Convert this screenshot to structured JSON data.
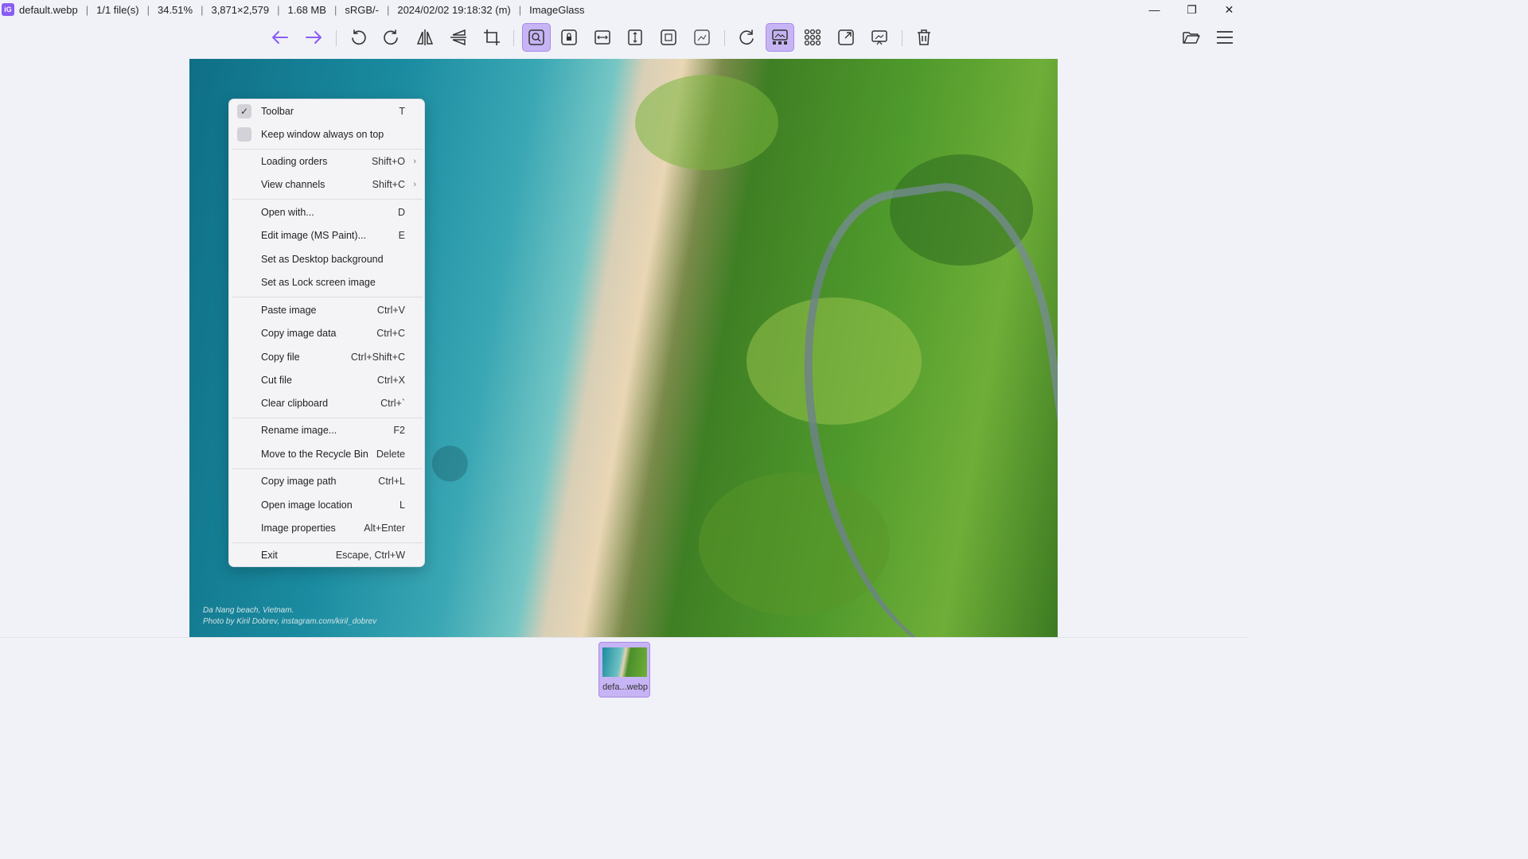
{
  "titlebar": {
    "app_icon_text": "iG",
    "filename": "default.webp",
    "file_count": "1/1 file(s)",
    "zoom": "34.51%",
    "dimensions": "3,871×2,579",
    "file_size": "1.68 MB",
    "color_profile": "sRGB/-",
    "date": "2024/02/02 19:18:32 (m)",
    "app_name": "ImageGlass",
    "separator": "|"
  },
  "window_controls": {
    "minimize": "—",
    "restore": "❐",
    "close": "✕"
  },
  "toolbar": {
    "accent_color": "#8a5cf6",
    "active_bg": "#c6b4f4",
    "buttons": [
      {
        "name": "previous-image-button",
        "icon": "arrow-left-icon",
        "active": false
      },
      {
        "name": "next-image-button",
        "icon": "arrow-right-icon",
        "active": false
      },
      {
        "name": "rotate-left-button",
        "icon": "rotate-left-icon",
        "active": false
      },
      {
        "name": "rotate-right-button",
        "icon": "rotate-right-icon",
        "active": false
      },
      {
        "name": "flip-horizontal-button",
        "icon": "flip-horizontal-icon",
        "active": false
      },
      {
        "name": "flip-vertical-button",
        "icon": "flip-vertical-icon",
        "active": false
      },
      {
        "name": "crop-button",
        "icon": "crop-icon",
        "active": false
      },
      {
        "name": "auto-zoom-button",
        "icon": "auto-zoom-icon",
        "active": true
      },
      {
        "name": "lock-zoom-button",
        "icon": "lock-zoom-icon",
        "active": false
      },
      {
        "name": "scale-to-width-button",
        "icon": "scale-to-width-icon",
        "active": false
      },
      {
        "name": "scale-to-height-button",
        "icon": "scale-to-height-icon",
        "active": false
      },
      {
        "name": "scale-to-fit-button",
        "icon": "scale-to-fit-icon",
        "active": false
      },
      {
        "name": "scale-to-fill-button",
        "icon": "scale-to-fill-icon",
        "active": false
      },
      {
        "name": "refresh-button",
        "icon": "refresh-icon",
        "active": false
      },
      {
        "name": "gallery-button",
        "icon": "gallery-icon",
        "active": true
      },
      {
        "name": "thumbnail-grid-button",
        "icon": "grid-icon",
        "active": false
      },
      {
        "name": "fullscreen-button",
        "icon": "fullscreen-icon",
        "active": false
      },
      {
        "name": "slideshow-button",
        "icon": "slideshow-icon",
        "active": false
      },
      {
        "name": "delete-button",
        "icon": "trash-icon",
        "active": false
      },
      {
        "name": "open-file-button",
        "icon": "folder-open-icon",
        "active": false
      },
      {
        "name": "main-menu-button",
        "icon": "hamburger-menu-icon",
        "active": false
      }
    ]
  },
  "image": {
    "caption_line1": "Da Nang beach, Vietnam.",
    "caption_line2": "Photo by Kiril Dobrev, instagram.com/kiril_dobrev"
  },
  "context_menu": {
    "items": [
      {
        "label": "Toolbar",
        "shortcut": "T",
        "checkbox": true,
        "checked": true
      },
      {
        "label": "Keep window always on top",
        "shortcut": "",
        "checkbox": true,
        "checked": false
      },
      {
        "label": "Loading orders",
        "shortcut": "Shift+O",
        "submenu": true
      },
      {
        "label": "View channels",
        "shortcut": "Shift+C",
        "submenu": true
      },
      {
        "label": "Open with...",
        "shortcut": "D"
      },
      {
        "label": "Edit image (MS Paint)...",
        "shortcut": "E"
      },
      {
        "label": "Set as Desktop background",
        "shortcut": ""
      },
      {
        "label": "Set as Lock screen image",
        "shortcut": ""
      },
      {
        "label": "Paste image",
        "shortcut": "Ctrl+V"
      },
      {
        "label": "Copy image data",
        "shortcut": "Ctrl+C"
      },
      {
        "label": "Copy file",
        "shortcut": "Ctrl+Shift+C"
      },
      {
        "label": "Cut file",
        "shortcut": "Ctrl+X"
      },
      {
        "label": "Clear clipboard",
        "shortcut": "Ctrl+`"
      },
      {
        "label": "Rename image...",
        "shortcut": "F2"
      },
      {
        "label": "Move to the Recycle Bin",
        "shortcut": "Delete"
      },
      {
        "label": "Copy image path",
        "shortcut": "Ctrl+L"
      },
      {
        "label": "Open image location",
        "shortcut": "L"
      },
      {
        "label": "Image properties",
        "shortcut": "Alt+Enter"
      },
      {
        "label": "Exit",
        "shortcut": "Escape, Ctrl+W"
      }
    ],
    "submenu_arrow": "›",
    "check_mark": "✓"
  },
  "thumbnail_bar": {
    "items": [
      {
        "label": "defa...webp",
        "selected": true
      }
    ]
  }
}
